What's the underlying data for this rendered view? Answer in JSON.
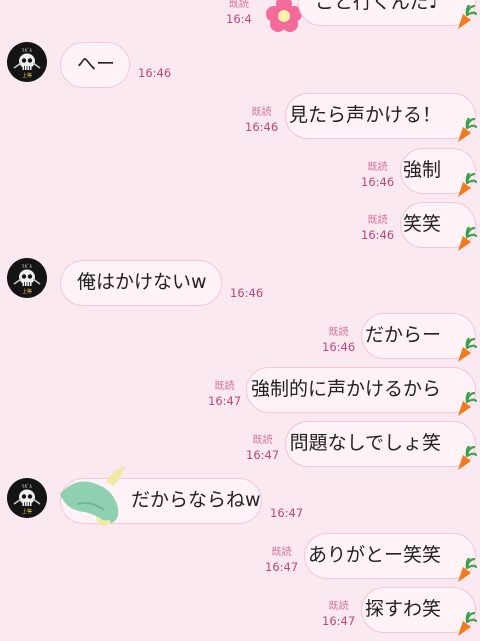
{
  "messages": [
    {
      "id": "m0",
      "dir": "out",
      "text": "こと行くんだ♪",
      "read": "既読",
      "time": "16:4"
    },
    {
      "id": "m1",
      "dir": "in",
      "text": "へー",
      "time": "16:46"
    },
    {
      "id": "m2",
      "dir": "out",
      "text": "見たら声かける！",
      "read": "既読",
      "time": "16:46"
    },
    {
      "id": "m3",
      "dir": "out",
      "text": "強制",
      "read": "既読",
      "time": "16:46"
    },
    {
      "id": "m4",
      "dir": "out",
      "text": "笑笑",
      "read": "既読",
      "time": "16:46"
    },
    {
      "id": "m5",
      "dir": "in",
      "text": "俺はかけないw",
      "time": "16:46"
    },
    {
      "id": "m6",
      "dir": "out",
      "text": "だからー",
      "read": "既読",
      "time": "16:46"
    },
    {
      "id": "m7",
      "dir": "out",
      "text": "強制的に声かけるから",
      "read": "既読",
      "time": "16:47"
    },
    {
      "id": "m8",
      "dir": "out",
      "text": "問題なしでしょ笑",
      "read": "既読",
      "time": "16:47"
    },
    {
      "id": "m9",
      "dir": "in",
      "text": "だからならねw",
      "time": "16:47"
    },
    {
      "id": "m10",
      "dir": "out",
      "text": "ありがとー笑笑",
      "read": "既読",
      "time": "16:47"
    },
    {
      "id": "m11",
      "dir": "out",
      "text": "探すわ笑",
      "read": "既読",
      "time": "16:47"
    }
  ],
  "colors": {
    "background": "#fbe9f1",
    "bubble_fill": "#fff3f7",
    "bubble_border": "#f3c8d8",
    "time_text": "#c0457a",
    "carrot": "#f07a1c"
  },
  "icons": {
    "avatar": "skull-avatar-icon",
    "bubble_tail": "carrot-icon",
    "sticker_top": "flower-sticker",
    "sticker_mid": "leaf-sticker"
  }
}
